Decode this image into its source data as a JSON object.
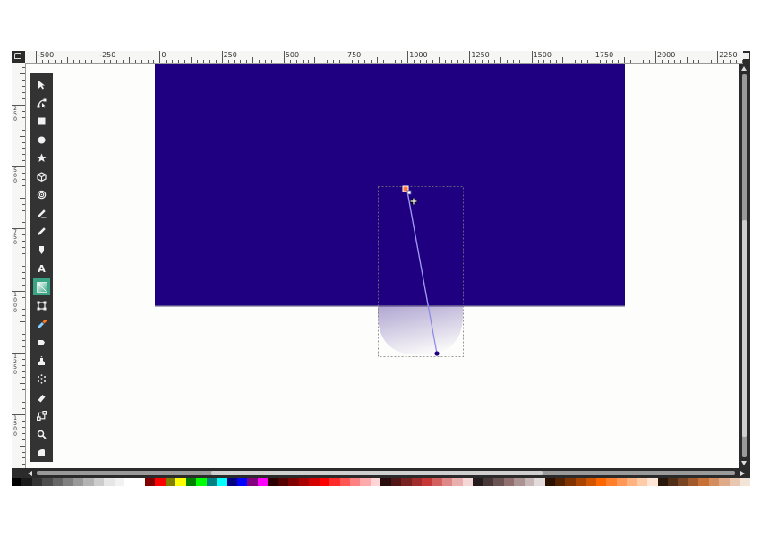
{
  "rulers": {
    "horizontal_labels": [
      "-500",
      "-250",
      "0",
      "250",
      "500",
      "750",
      "1000",
      "1250",
      "1500",
      "1750",
      "2000",
      "2250"
    ],
    "vertical_labels": [
      {
        "chars": [
          "2",
          "5",
          "0"
        ]
      },
      {
        "chars": [
          "5",
          "0",
          "0"
        ]
      },
      {
        "chars": [
          "7",
          "5",
          "0"
        ]
      },
      {
        "chars": [
          "1",
          "0",
          "0",
          "0"
        ]
      },
      {
        "chars": [
          "1",
          "2",
          "5",
          "0"
        ]
      },
      {
        "chars": [
          "1",
          "5",
          "0",
          "0"
        ]
      }
    ]
  },
  "toolbox": {
    "tools": [
      {
        "name": "select-tool",
        "icon": "arrow-pointer-icon"
      },
      {
        "name": "node-tool",
        "icon": "node-edit-icon"
      },
      {
        "name": "rectangle-tool",
        "icon": "square-icon"
      },
      {
        "name": "ellipse-tool",
        "icon": "circle-icon"
      },
      {
        "name": "star-tool",
        "icon": "star-icon"
      },
      {
        "name": "3d-box-tool",
        "icon": "cube-icon"
      },
      {
        "name": "spiral-tool",
        "icon": "spiral-icon"
      },
      {
        "name": "pen-tool",
        "icon": "pen-icon"
      },
      {
        "name": "pencil-tool",
        "icon": "pencil-icon"
      },
      {
        "name": "calligraphy-tool",
        "icon": "calligraphy-icon"
      },
      {
        "name": "text-tool",
        "icon": "text-a-icon",
        "glyph": "A"
      },
      {
        "name": "gradient-tool",
        "icon": "gradient-icon",
        "active": true
      },
      {
        "name": "mesh-tool",
        "icon": "mesh-icon"
      },
      {
        "name": "dropper-tool",
        "icon": "dropper-icon"
      },
      {
        "name": "paint-bucket-tool",
        "icon": "bucket-icon"
      },
      {
        "name": "tweak-tool",
        "icon": "tweak-icon"
      },
      {
        "name": "spray-tool",
        "icon": "spray-icon"
      },
      {
        "name": "eraser-tool",
        "icon": "eraser-icon"
      },
      {
        "name": "connector-tool",
        "icon": "connector-icon"
      },
      {
        "name": "zoom-tool",
        "icon": "magnifier-icon"
      },
      {
        "name": "measure-tool",
        "icon": "measure-icon"
      }
    ]
  },
  "canvas": {
    "page_background": "#fdfdfb",
    "rectangle_fill": "#1f0081",
    "gradient_stop_color": "#1f0081",
    "gradient_handle_color": "#1f0081"
  },
  "palette": {
    "colors": [
      "#000000",
      "#1a1a1a",
      "#333333",
      "#4d4d4d",
      "#666666",
      "#808080",
      "#999999",
      "#b3b3b3",
      "#cccccc",
      "#e6e6e6",
      "#f2f2f2",
      "#ffffff",
      "#ffffff",
      "#800000",
      "#ff0000",
      "#808000",
      "#ffff00",
      "#008000",
      "#00ff00",
      "#008080",
      "#00ffff",
      "#000080",
      "#0000ff",
      "#800080",
      "#ff00ff",
      "#2b0000",
      "#550000",
      "#800000",
      "#aa0000",
      "#d40000",
      "#ff0000",
      "#ff2a2a",
      "#ff5555",
      "#ff8080",
      "#ffaaaa",
      "#ffd5d5",
      "#280b0b",
      "#501616",
      "#782121",
      "#a02c2c",
      "#c83737",
      "#d35f5f",
      "#de8787",
      "#e9afaf",
      "#f4d7d7",
      "#241c1c",
      "#483737",
      "#6c5353",
      "#916f6f",
      "#ac9393",
      "#c8b7b7",
      "#e3dbdb",
      "#2b1100",
      "#552200",
      "#803300",
      "#aa4400",
      "#d45500",
      "#ff6600",
      "#ff7f2a",
      "#ff9955",
      "#ffb380",
      "#ffccaa",
      "#ffe6d5",
      "#28170b",
      "#502d16",
      "#784421",
      "#a05a2c",
      "#c87137",
      "#d38d5f",
      "#deaa87",
      "#e9c6af",
      "#f4e3d7"
    ]
  }
}
